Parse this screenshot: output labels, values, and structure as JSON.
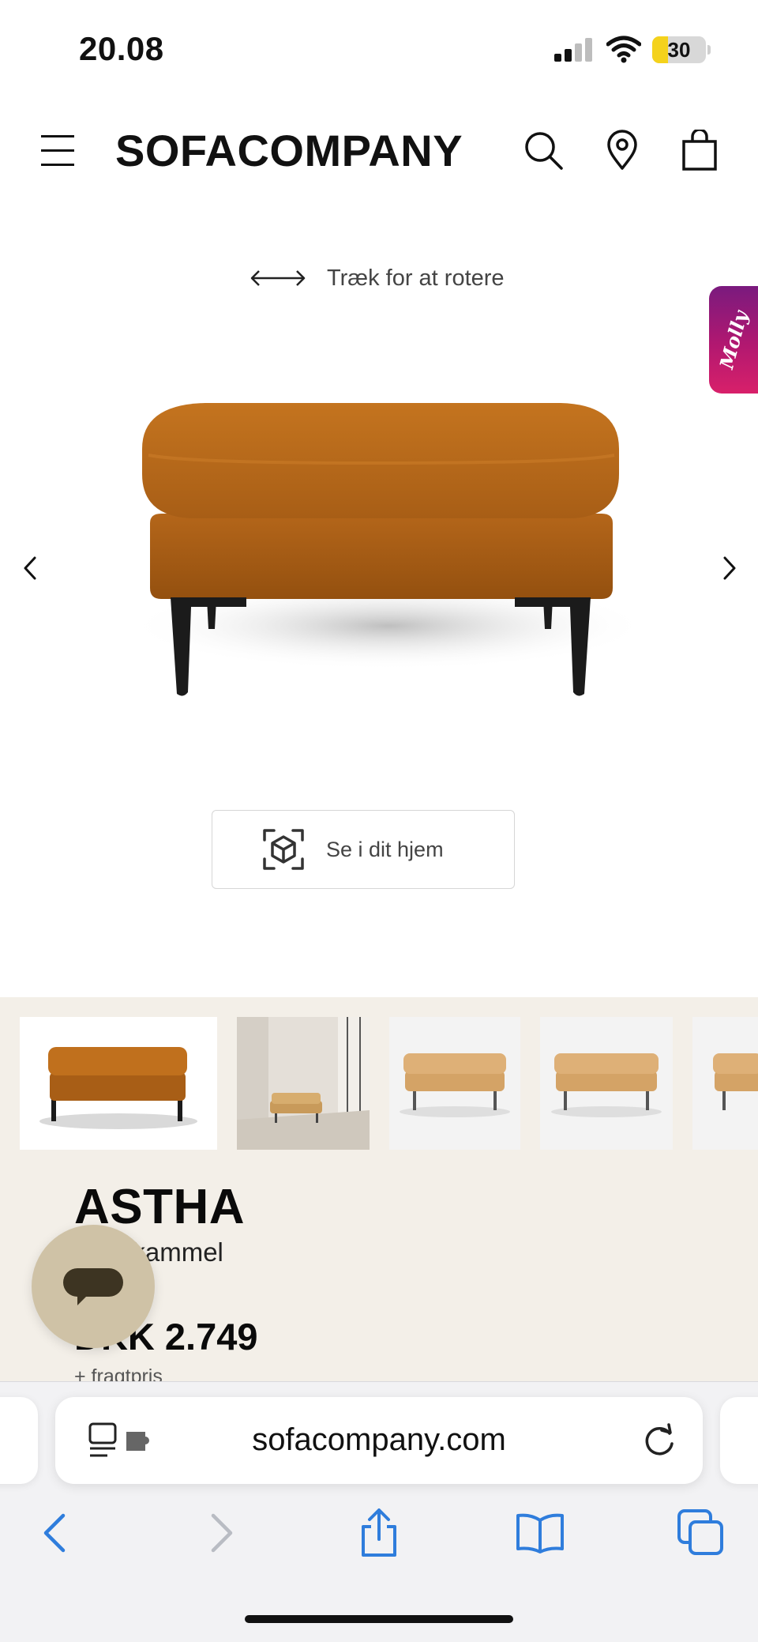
{
  "status_bar": {
    "time": "20.08",
    "battery_level": "30"
  },
  "header": {
    "brand": "SOFACOMPANY",
    "icons": [
      "menu-icon",
      "search-icon",
      "location-pin-icon",
      "shopping-bag-icon"
    ]
  },
  "viewer": {
    "rotate_hint": "Træk for at rotere",
    "chat_tab_label": "Molly",
    "ar_button_label": "Se i dit hjem"
  },
  "product": {
    "name": "ASTHA",
    "type": "Fodskammel",
    "price": "DKK 2.749",
    "freight_note": "+ fragtpris",
    "colors": {
      "velvet": "#b8681c",
      "sand": "#d9ad72",
      "legs": "#1b1b1b"
    }
  },
  "gallery": {
    "thumbnails": [
      "ottoman-orange-velvet",
      "ottoman-room-scene",
      "ottoman-sand-left",
      "ottoman-sand-right",
      "ottoman-sand-partial"
    ]
  },
  "browser": {
    "url": "sofacompany.com",
    "toolbar_icons": [
      "back-icon",
      "forward-icon",
      "share-icon",
      "bookmarks-icon",
      "tabs-icon"
    ]
  }
}
